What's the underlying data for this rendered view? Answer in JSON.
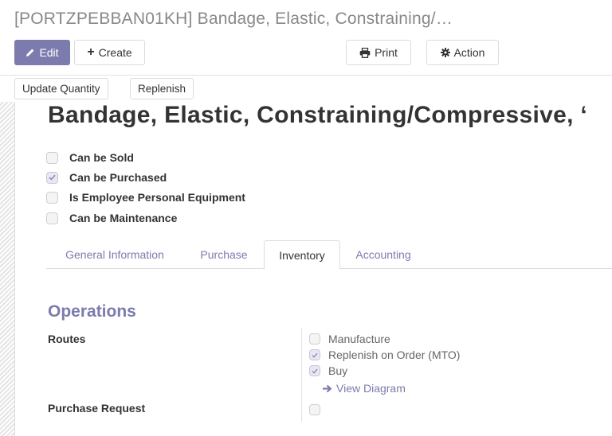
{
  "breadcrumb": {
    "title": "[PORTZPEBBAN01KH] Bandage, Elastic, Constraining/…"
  },
  "toolbar": {
    "edit_label": "Edit",
    "create_label": "Create",
    "print_label": "Print",
    "action_label": "Action"
  },
  "status_buttons": {
    "update_quantity_label": "Update Quantity",
    "replenish_label": "Replenish"
  },
  "product": {
    "name": "Bandage, Elastic, Constraining/Compressive, ‘",
    "flags": [
      {
        "label": "Can be Sold",
        "checked": false
      },
      {
        "label": "Can be Purchased",
        "checked": true
      },
      {
        "label": "Is Employee Personal Equipment",
        "checked": false
      },
      {
        "label": "Can be Maintenance",
        "checked": false
      }
    ]
  },
  "tabs": [
    {
      "label": "General Information",
      "active": false
    },
    {
      "label": "Purchase",
      "active": false
    },
    {
      "label": "Inventory",
      "active": true
    },
    {
      "label": "Accounting",
      "active": false
    }
  ],
  "operations": {
    "title": "Operations",
    "routes_label": "Routes",
    "routes": [
      {
        "label": "Manufacture",
        "checked": false
      },
      {
        "label": "Replenish on Order (MTO)",
        "checked": true
      },
      {
        "label": "Buy",
        "checked": true
      }
    ],
    "view_diagram_label": "View Diagram",
    "purchase_request_label": "Purchase Request",
    "purchase_request_checked": false
  },
  "colors": {
    "accent": "#7c7bad",
    "text": "#333333",
    "muted": "#888888"
  },
  "icons": {
    "edit": "pencil-icon",
    "create": "plus-icon",
    "print": "printer-icon",
    "action": "gear-icon",
    "view_diagram": "arrow-right-icon",
    "checkbox_checked": "check-icon"
  }
}
